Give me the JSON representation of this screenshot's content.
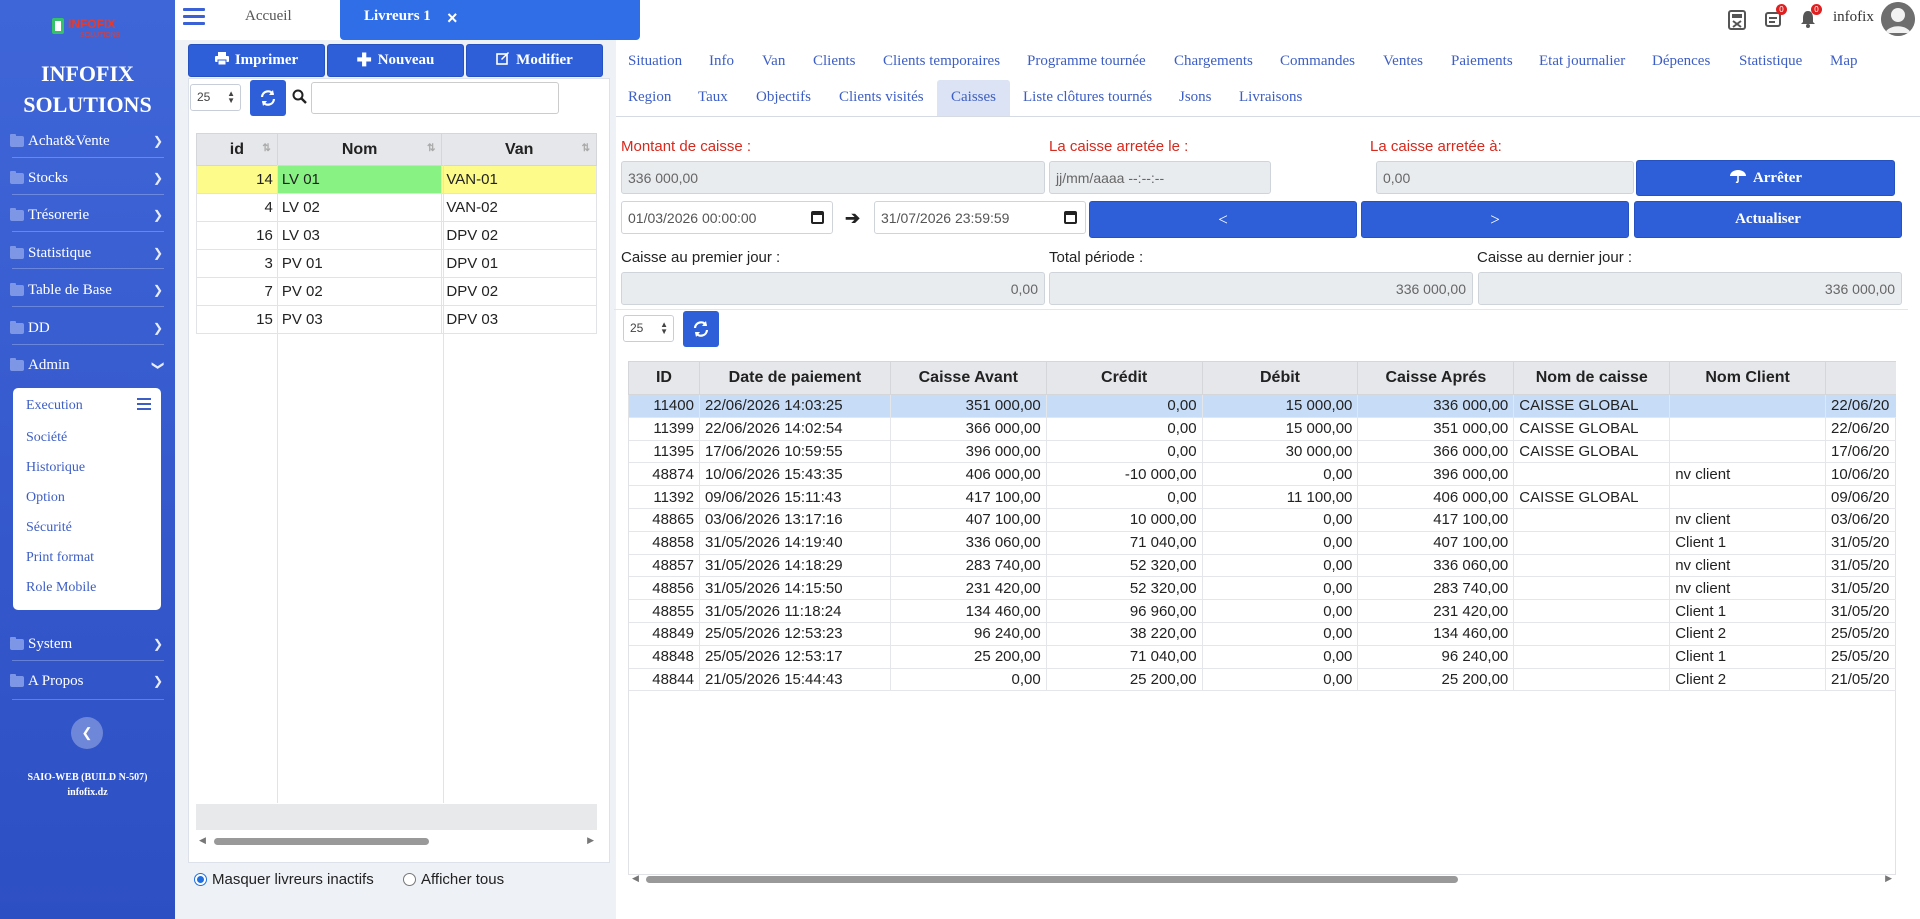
{
  "sidebar": {
    "logo_text": "INFOFIX SOLUTIONS",
    "company_line1": "INFOFIX",
    "company_line2": "SOLUTIONS",
    "items": [
      {
        "label": "Achat&Vente"
      },
      {
        "label": "Stocks"
      },
      {
        "label": "Trésorerie"
      },
      {
        "label": "Statistique"
      },
      {
        "label": "Table de Base"
      },
      {
        "label": "DD"
      },
      {
        "label": "Admin"
      },
      {
        "label": "System"
      },
      {
        "label": "A Propos"
      }
    ],
    "submenu": [
      "Execution",
      "Société",
      "Historique",
      "Option",
      "Sécurité",
      "Print format",
      "Role Mobile"
    ],
    "build": "SAIO-WEB (BUILD N-507)",
    "site": "infofix.dz"
  },
  "topbar": {
    "home_tab": "Accueil",
    "active_tab": "Livreurs 1",
    "close_symbol": "×",
    "badge_messages": "0",
    "badge_notifications": "0",
    "user": "infofix"
  },
  "left_panel": {
    "print_label": "Imprimer",
    "new_label": "Nouveau",
    "edit_label": "Modifier",
    "page_size": "25",
    "columns": [
      "id",
      "Nom",
      "Van"
    ],
    "rows": [
      {
        "id": "14",
        "nom": "LV 01",
        "van": "VAN-01"
      },
      {
        "id": "4",
        "nom": "LV 02",
        "van": "VAN-02"
      },
      {
        "id": "16",
        "nom": "LV 03",
        "van": "DPV 02"
      },
      {
        "id": "3",
        "nom": "PV 01",
        "van": "DPV 01"
      },
      {
        "id": "7",
        "nom": "PV 02",
        "van": "DPV 02"
      },
      {
        "id": "15",
        "nom": "PV 03",
        "van": "DPV 03"
      }
    ],
    "radio_hide": "Masquer livreurs inactifs",
    "radio_all": "Afficher tous"
  },
  "right_panel": {
    "tabs_row1": [
      "Situation",
      "Info",
      "Van",
      "Clients",
      "Clients temporaires",
      "Programme tournée",
      "Chargements",
      "Commandes",
      "Ventes",
      "Paiements",
      "Etat journalier",
      "Dépences",
      "Statistique",
      "Map"
    ],
    "tabs_row2": [
      "Region",
      "Taux",
      "Objectifs",
      "Clients visités",
      "Caisses",
      "Liste clôtures tournés",
      "Jsons",
      "Livraisons"
    ],
    "montant_label": "Montant de caisse :",
    "montant_value": "336 000,00",
    "arretee_le_label": "La caisse arretée le :",
    "arretee_le_placeholder": "jj/mm/aaaa  --:--:--",
    "arretee_a_label": "La caisse arretée à:",
    "arretee_a_value": "0,00",
    "arreter_label": "Arrêter",
    "date_from": "01/03/2026  00:00:00",
    "date_to": "31/07/2026  23:59:59",
    "prev_label": "<",
    "next_label": ">",
    "refresh_label": "Actualiser",
    "premier_jour_label": "Caisse au premier jour :",
    "premier_jour_value": "0,00",
    "total_periode_label": "Total période :",
    "total_periode_value": "336 000,00",
    "dernier_jour_label": "Caisse au dernier jour :",
    "dernier_jour_value": "336 000,00",
    "page_size": "25",
    "grid_columns": [
      "ID",
      "Date de paiement",
      "Caisse Avant",
      "Crédit",
      "Débit",
      "Caisse Aprés",
      "Nom de caisse",
      "Nom Client",
      "("
    ],
    "grid_rows": [
      [
        "11400",
        "22/06/2026 14:03:25",
        "351 000,00",
        "0,00",
        "15 000,00",
        "336 000,00",
        "CAISSE GLOBAL",
        "",
        "22/06/20"
      ],
      [
        "11399",
        "22/06/2026 14:02:54",
        "366 000,00",
        "0,00",
        "15 000,00",
        "351 000,00",
        "CAISSE GLOBAL",
        "",
        "22/06/20"
      ],
      [
        "11395",
        "17/06/2026 10:59:55",
        "396 000,00",
        "0,00",
        "30 000,00",
        "366 000,00",
        "CAISSE GLOBAL",
        "",
        "17/06/20"
      ],
      [
        "48874",
        "10/06/2026 15:43:35",
        "406 000,00",
        "-10 000,00",
        "0,00",
        "396 000,00",
        "",
        "nv client",
        "10/06/20"
      ],
      [
        "11392",
        "09/06/2026 15:11:43",
        "417 100,00",
        "0,00",
        "11 100,00",
        "406 000,00",
        "CAISSE GLOBAL",
        "",
        "09/06/20"
      ],
      [
        "48865",
        "03/06/2026 13:17:16",
        "407 100,00",
        "10 000,00",
        "0,00",
        "417 100,00",
        "",
        "nv client",
        "03/06/20"
      ],
      [
        "48858",
        "31/05/2026 14:19:40",
        "336 060,00",
        "71 040,00",
        "0,00",
        "407 100,00",
        "",
        "Client 1",
        "31/05/20"
      ],
      [
        "48857",
        "31/05/2026 14:18:29",
        "283 740,00",
        "52 320,00",
        "0,00",
        "336 060,00",
        "",
        "nv client",
        "31/05/20"
      ],
      [
        "48856",
        "31/05/2026 14:15:50",
        "231 420,00",
        "52 320,00",
        "0,00",
        "283 740,00",
        "",
        "nv client",
        "31/05/20"
      ],
      [
        "48855",
        "31/05/2026 11:18:24",
        "134 460,00",
        "96 960,00",
        "0,00",
        "231 420,00",
        "",
        "Client 1",
        "31/05/20"
      ],
      [
        "48849",
        "25/05/2026 12:53:23",
        "96 240,00",
        "38 220,00",
        "0,00",
        "134 460,00",
        "",
        "Client 2",
        "25/05/20"
      ],
      [
        "48848",
        "25/05/2026 12:53:17",
        "25 200,00",
        "71 040,00",
        "0,00",
        "96 240,00",
        "",
        "Client 1",
        "25/05/20"
      ],
      [
        "48844",
        "21/05/2026 15:44:43",
        "0,00",
        "25 200,00",
        "0,00",
        "25 200,00",
        "",
        "Client 2",
        "21/05/20"
      ]
    ]
  },
  "colors": {
    "sidebar": "#2f55c9",
    "primary": "#2e5fd9",
    "tab_active": "#2f6ee6",
    "selected_row": "#c7dcf6",
    "highlight_yellow": "#fdfb8a",
    "highlight_green": "#88f283",
    "label_red": "#d52a1e"
  }
}
